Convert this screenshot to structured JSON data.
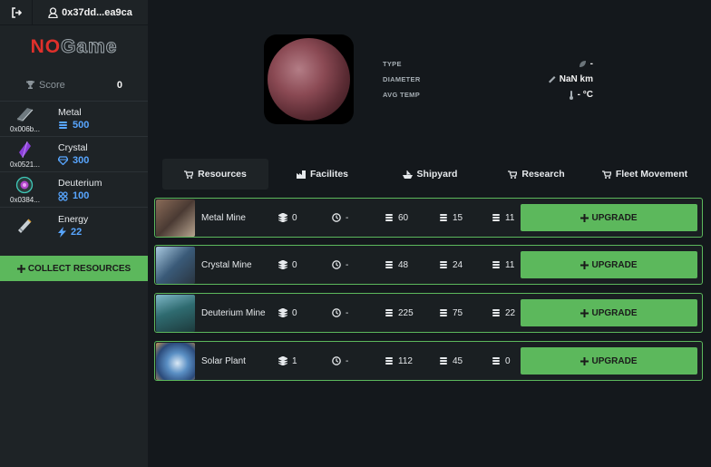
{
  "header": {
    "wallet": "0x37dd...ea9ca"
  },
  "logo": {
    "part1": "NO",
    "part2": "Game"
  },
  "score": {
    "label": "Score",
    "value": "0"
  },
  "resources": [
    {
      "name": "Metal",
      "address": "0x006b...",
      "amount": "500"
    },
    {
      "name": "Crystal",
      "address": "0x0521...",
      "amount": "300"
    },
    {
      "name": "Deuterium",
      "address": "0x0384...",
      "amount": "100"
    },
    {
      "name": "Energy",
      "address": "",
      "amount": "22"
    }
  ],
  "collect_label": "COLLECT RESOURCES",
  "planet": {
    "type_label": "TYPE",
    "type_value": "-",
    "diameter_label": "DIAMETER",
    "diameter_value": "NaN km",
    "temp_label": "AVG TEMP",
    "temp_value": "- °C"
  },
  "tabs": [
    {
      "label": "Resources",
      "active": true
    },
    {
      "label": "Facilites"
    },
    {
      "label": "Shipyard"
    },
    {
      "label": "Research"
    },
    {
      "label": "Fleet Movement"
    }
  ],
  "buildings": [
    {
      "name": "Metal Mine",
      "level": "0",
      "time": "-",
      "cost1": "60",
      "cost2": "15",
      "cost3": "11"
    },
    {
      "name": "Crystal Mine",
      "level": "0",
      "time": "-",
      "cost1": "48",
      "cost2": "24",
      "cost3": "11"
    },
    {
      "name": "Deuterium Mine",
      "level": "0",
      "time": "-",
      "cost1": "225",
      "cost2": "75",
      "cost3": "22"
    },
    {
      "name": "Solar Plant",
      "level": "1",
      "time": "-",
      "cost1": "112",
      "cost2": "45",
      "cost3": "0"
    }
  ],
  "upgrade_label": "UPGRADE",
  "colors": {
    "accent": "#5cb85c",
    "amount": "#58a6ff",
    "sidebar": "#1e2326",
    "background": "#14181c"
  }
}
